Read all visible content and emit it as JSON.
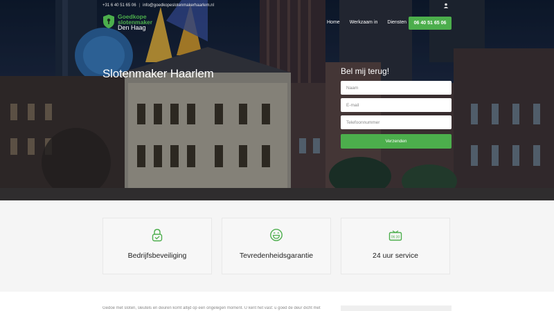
{
  "topbar": {
    "phone": "+31 6 40 51 65 06",
    "separator": "|",
    "email": "info@goedkopeslotenmakerhaarlem.nl"
  },
  "logo": {
    "line1": "Goedkope",
    "line2": "slotenmaker",
    "line3": "Den Haag"
  },
  "nav": {
    "items": [
      "Home",
      "Werkzaam in",
      "Diensten"
    ],
    "phone_button": "06 40 51 65 06"
  },
  "hero": {
    "title": "Slotenmaker Haarlem"
  },
  "callback_form": {
    "title": "Bel mij terug!",
    "name_placeholder": "Naam",
    "email_placeholder": "E-mail",
    "phone_placeholder": "Telefoonnummer",
    "submit_label": "Verzenden"
  },
  "features": [
    {
      "icon": "lock-icon",
      "label": "Bedrijfsbeveiliging"
    },
    {
      "icon": "smiley-icon",
      "label": "Tevredenheidsgarantie"
    },
    {
      "icon": "clock-radio-icon",
      "label": "24 uur service",
      "icon_text": "06:30"
    }
  ],
  "intro_text": "Gedoe met sloten, sleutels en deuren komt altijd op een ongelegen moment. U kent het vast: u goed de deur dicht met",
  "colors": {
    "accent": "#4cae4c",
    "hero_dark": "#0c1a2e"
  }
}
